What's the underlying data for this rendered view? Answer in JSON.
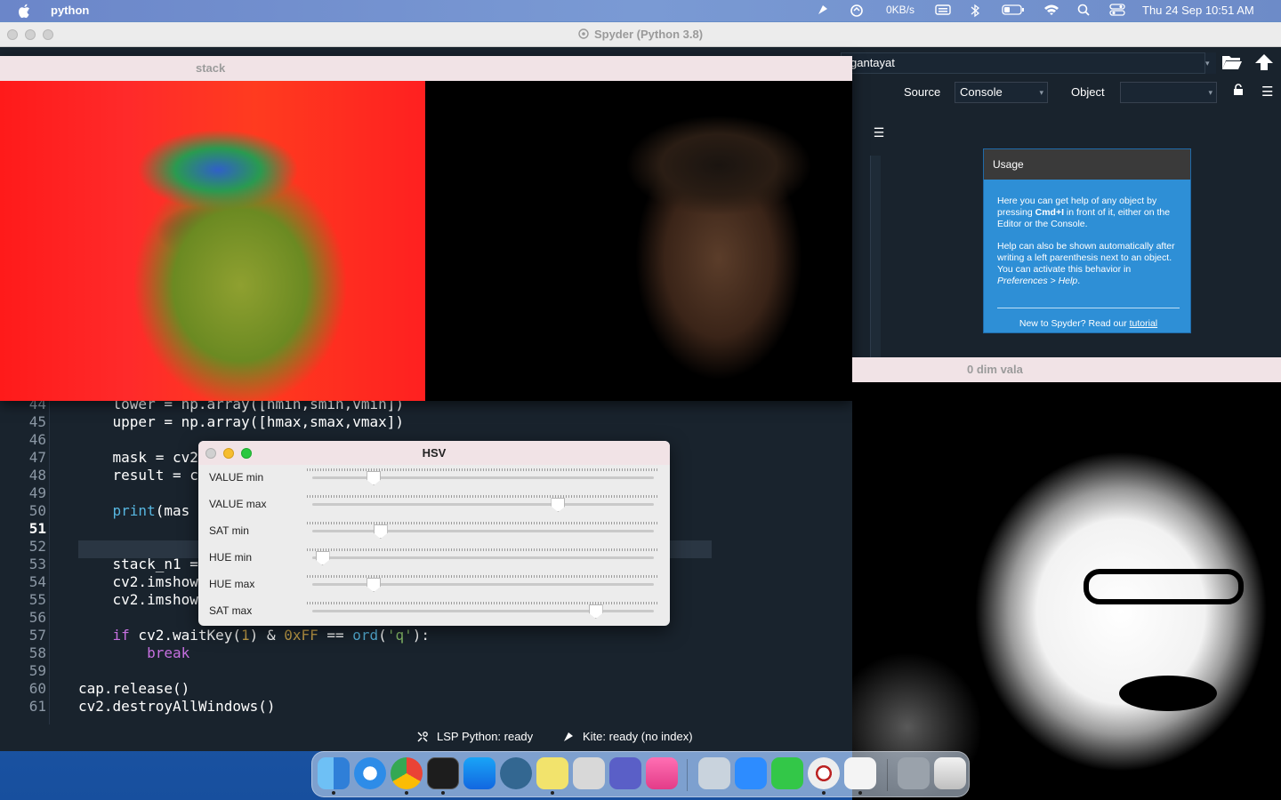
{
  "menubar": {
    "app_name": "python",
    "network": "0KB/s",
    "datetime": "Thu 24 Sep  10:51 AM"
  },
  "spyder": {
    "title": "Spyder (Python 3.8)",
    "path": "gantayat",
    "help": {
      "source_label": "Source",
      "source_value": "Console",
      "object_label": "Object",
      "object_value": "",
      "usage": {
        "title": "Usage",
        "para1_a": "Here you can get help of any object by pressing ",
        "para1_key": "Cmd+I",
        "para1_b": " in front of it, either on the Editor or the Console.",
        "para2_a": "Help can also be shown automatically after writing a left parenthesis next to an object. You can activate this behavior in ",
        "para2_em": "Preferences > Help",
        "para2_b": ".",
        "footer_a": "New to Spyder? Read our ",
        "footer_link": "tutorial"
      }
    },
    "editor": {
      "line_numbers": [
        "44",
        "45",
        "46",
        "47",
        "48",
        "49",
        "50",
        "51",
        "52",
        "53",
        "54",
        "55",
        "56",
        "57",
        "58",
        "59",
        "60",
        "61"
      ],
      "current_line": "51",
      "lines": {
        "l44": "    lower = np.array([hmin,smin,vmin])",
        "l45": "    upper = np.array([hmax,smax,vmax])",
        "l47": "    mask = cv2",
        "l48": "    result = c",
        "l50_fn": "print",
        "l50_rest": "(mas",
        "l53": "    stack_n1 =",
        "l54": "    cv2.imshow",
        "l55": "    cv2.imshow",
        "l57_kw": "if",
        "l57_a": " cv2.waitKey(",
        "l57_n1": "1",
        "l57_b": ") & ",
        "l57_n2": "0xFF",
        "l57_c": " == ",
        "l57_fn": "ord",
        "l57_d": "(",
        "l57_s": "'q'",
        "l57_e": "):",
        "l58": "break",
        "l60": "cap.release()",
        "l61": "cv2.destroyAllWindows()"
      }
    },
    "status": {
      "lsp": "LSP Python: ready",
      "kite": "Kite: ready (no index)"
    }
  },
  "stack_window": {
    "title": "stack"
  },
  "dim_window": {
    "title": "0 dim vala"
  },
  "hsv_window": {
    "title": "HSV",
    "sliders": [
      {
        "label": "VALUE min",
        "level": 0.18
      },
      {
        "label": "VALUE max",
        "level": 0.72
      },
      {
        "label": "SAT min",
        "level": 0.2
      },
      {
        "label": "HUE min",
        "level": 0.03
      },
      {
        "label": "HUE max",
        "level": 0.18
      },
      {
        "label": "SAT max",
        "level": 0.83
      }
    ]
  },
  "dock": {
    "apps": [
      "finder-icon",
      "safari-icon",
      "chrome-icon",
      "terminal-icon",
      "app-store-icon",
      "postgres-icon",
      "stickies-icon",
      "screenshot-icon",
      "teams-icon",
      "creativit-icon",
      "preview-icon",
      "zoom-icon",
      "facetime-icon",
      "spyder-icon",
      "document-icon",
      "downloads-icon",
      "trash-icon"
    ]
  }
}
